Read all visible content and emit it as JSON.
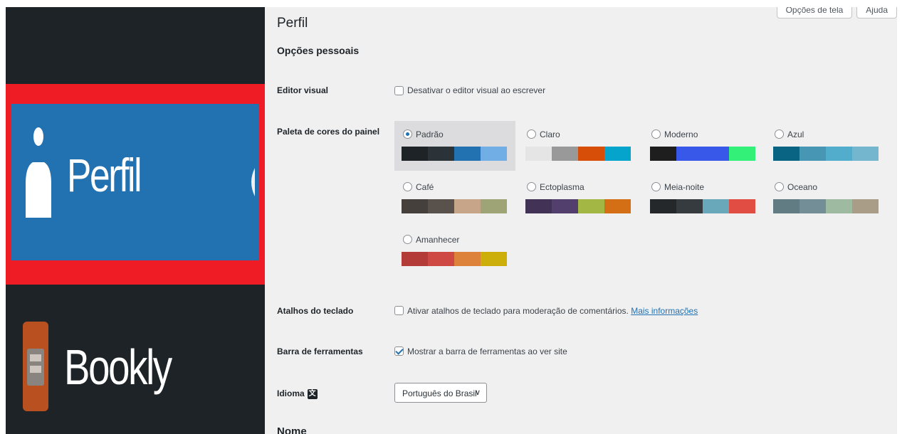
{
  "sidebar": {
    "items": [
      {
        "label": "Perfil",
        "icon": "user-icon",
        "active": true
      },
      {
        "label": "Bookly",
        "icon": "bookly-icon",
        "active": false
      }
    ],
    "active_highlight": "#ef1c25",
    "active_bg": "#2271b1",
    "bg": "#1d2327"
  },
  "header": {
    "screen_options": "Opções de tela",
    "help": "Ajuda",
    "title": "Perfil"
  },
  "personal": {
    "section_title": "Opções pessoais",
    "visual_editor": {
      "label": "Editor visual",
      "checkbox_text": "Desativar o editor visual ao escrever",
      "checked": false
    },
    "admin_color": {
      "label": "Paleta de cores do painel",
      "palettes": [
        {
          "name": "Padrão",
          "selected": true,
          "colors": [
            "#1d2327",
            "#2c3338",
            "#2271b1",
            "#72aee6"
          ]
        },
        {
          "name": "Claro",
          "selected": false,
          "colors": [
            "#e5e5e5",
            "#999999",
            "#d64e07",
            "#04a4cc"
          ]
        },
        {
          "name": "Moderno",
          "selected": false,
          "colors": [
            "#1e1e1e",
            "#3858e9",
            "#3858e9",
            "#33f078"
          ]
        },
        {
          "name": "Azul",
          "selected": false,
          "colors": [
            "#096484",
            "#4796b3",
            "#52accc",
            "#74b6ce"
          ]
        },
        {
          "name": "Café",
          "selected": false,
          "colors": [
            "#46403c",
            "#59524c",
            "#c7a589",
            "#9ea476"
          ]
        },
        {
          "name": "Ectoplasma",
          "selected": false,
          "colors": [
            "#413256",
            "#523f6d",
            "#a3b745",
            "#d46f15"
          ]
        },
        {
          "name": "Meia-noite",
          "selected": false,
          "colors": [
            "#25282b",
            "#363b3f",
            "#69a8bb",
            "#e14d43"
          ]
        },
        {
          "name": "Oceano",
          "selected": false,
          "colors": [
            "#627c83",
            "#738e96",
            "#9ebaa0",
            "#aa9d88"
          ]
        },
        {
          "name": "Amanhecer",
          "selected": false,
          "colors": [
            "#b43c38",
            "#cf4944",
            "#dd823b",
            "#ccaf0b"
          ]
        }
      ]
    },
    "keyboard": {
      "label": "Atalhos do teclado",
      "checkbox_text": "Ativar atalhos de teclado para moderação de comentários.",
      "link": "Mais informações",
      "checked": false
    },
    "toolbar": {
      "label": "Barra de ferramentas",
      "checkbox_text": "Mostrar a barra de ferramentas ao ver site",
      "checked": true
    },
    "language": {
      "label": "Idioma",
      "icon": "translation-icon",
      "selected": "Português do Brasil"
    }
  },
  "next_section_title": "Nome"
}
